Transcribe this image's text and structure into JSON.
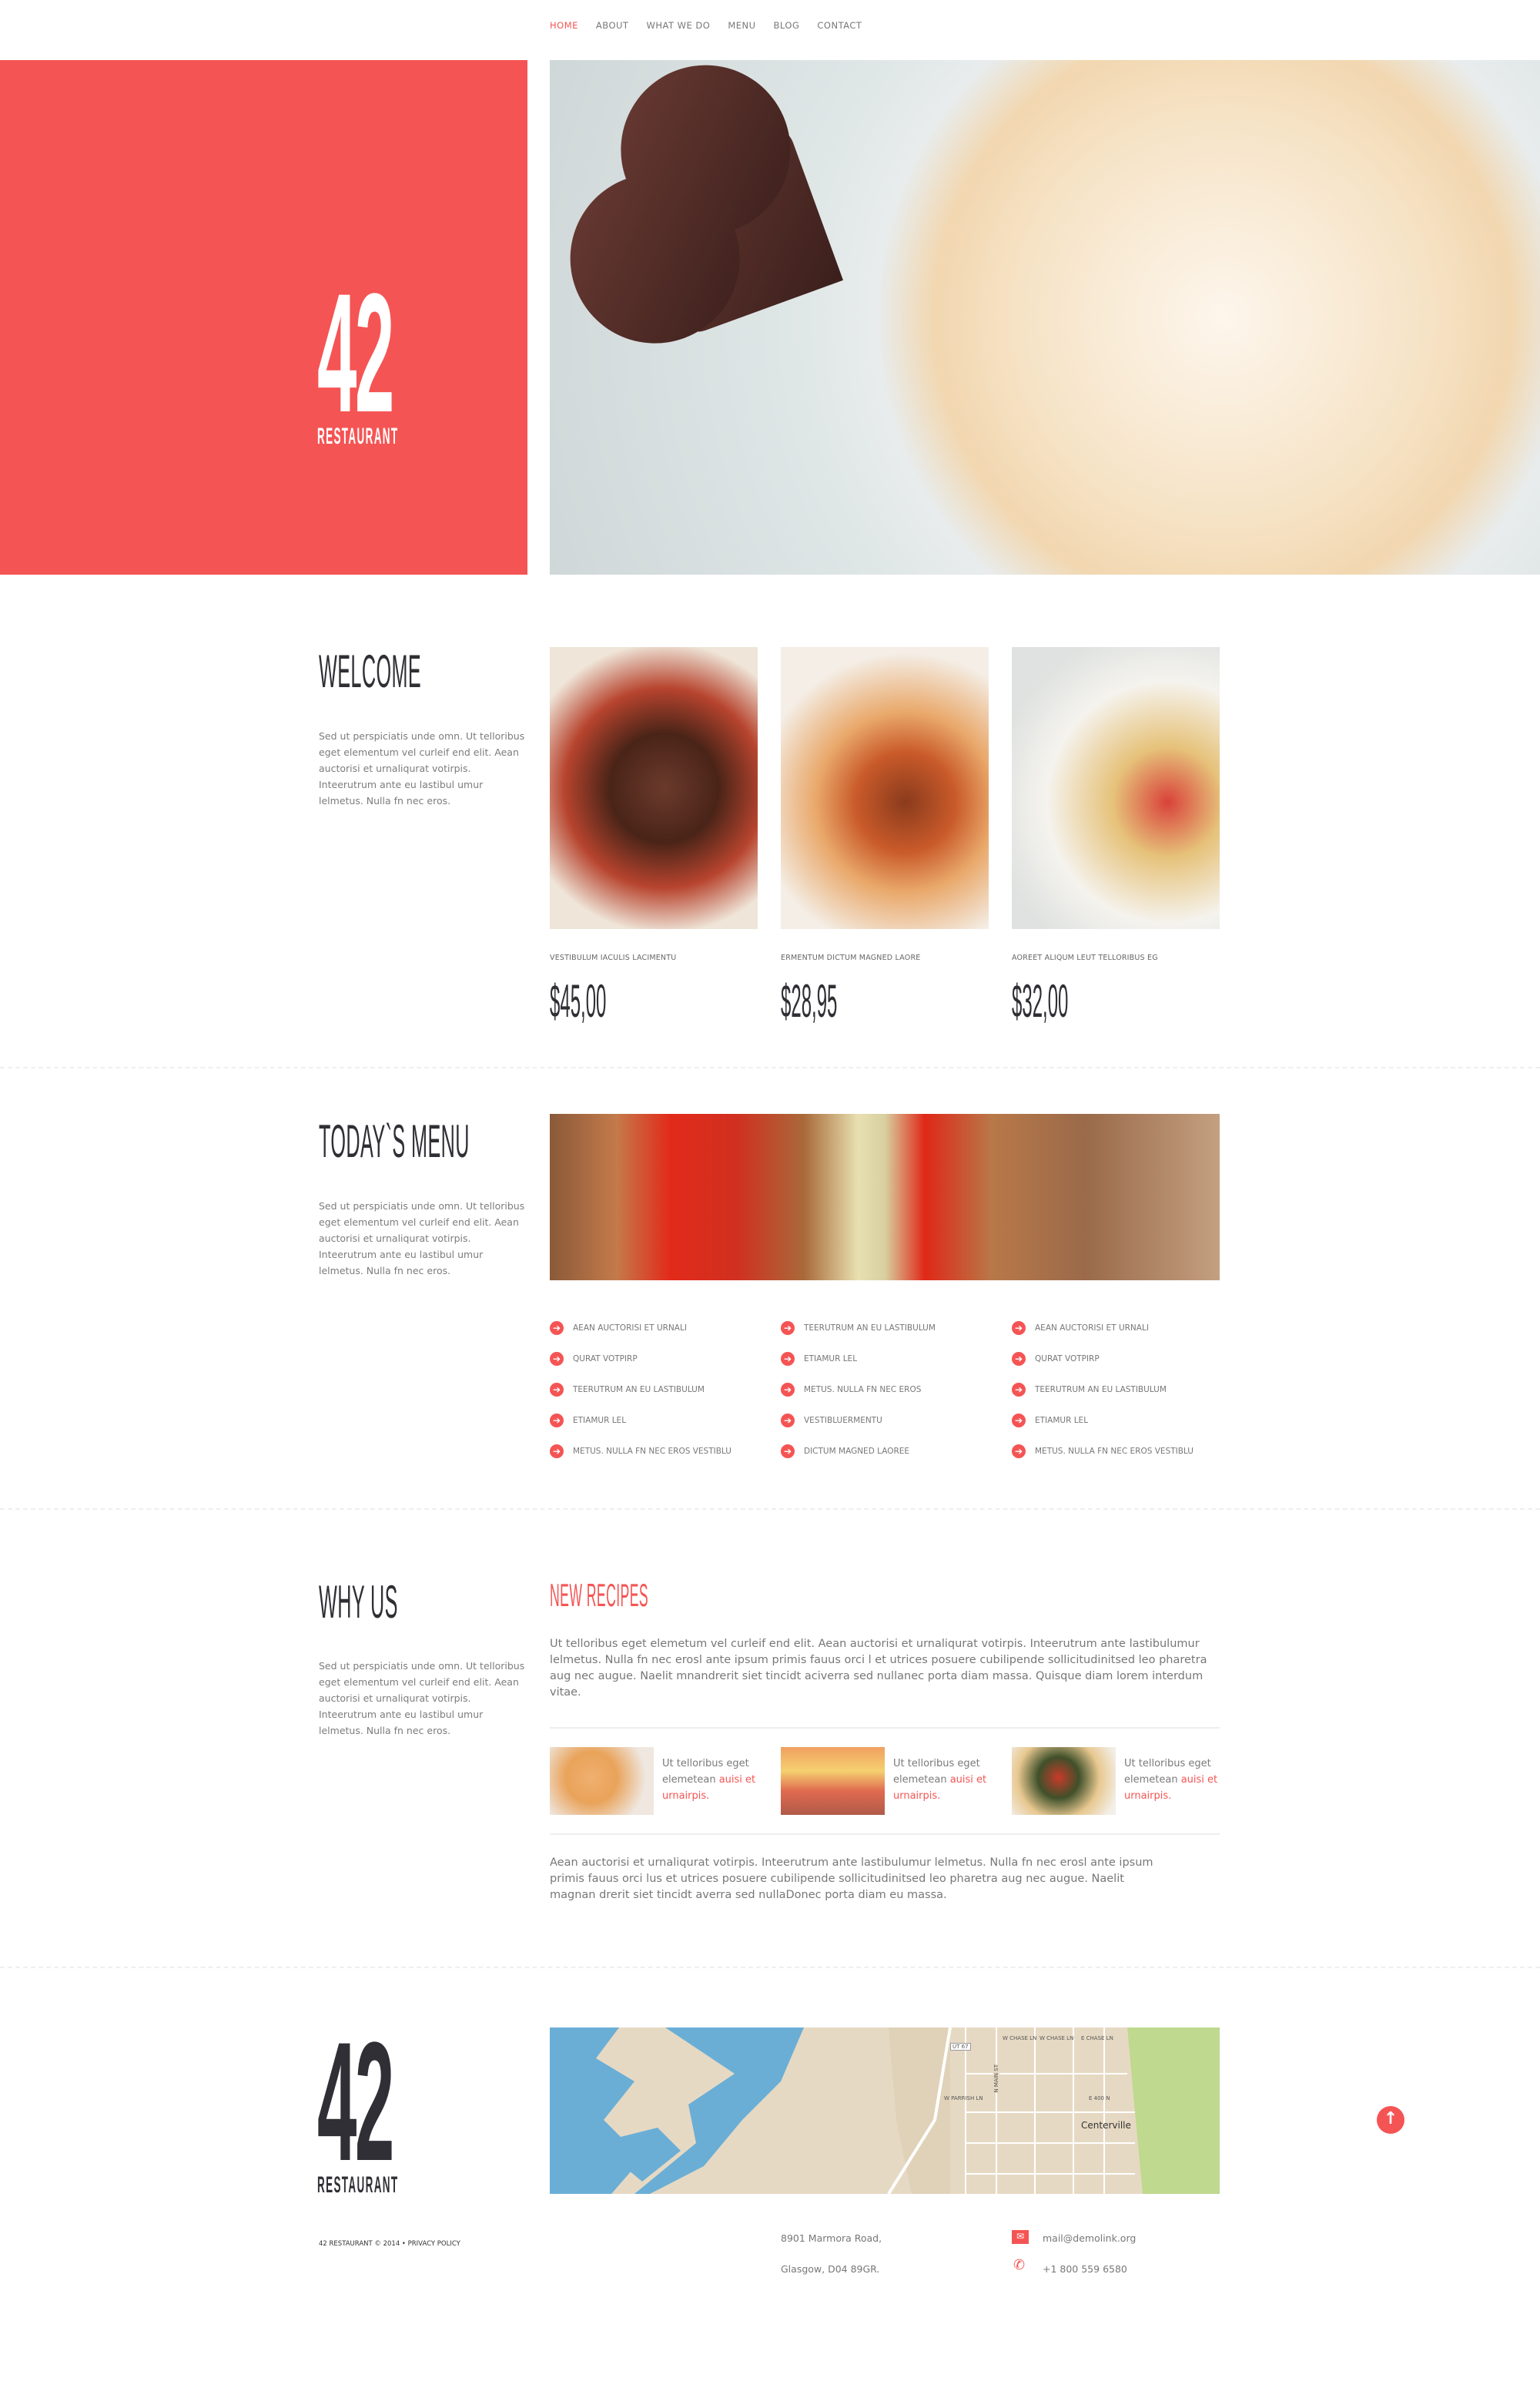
{
  "nav": {
    "items": [
      {
        "label": "HOME",
        "active": true
      },
      {
        "label": "ABOUT"
      },
      {
        "label": "WHAT WE DO"
      },
      {
        "label": "MENU"
      },
      {
        "label": "BLOG"
      },
      {
        "label": "CONTACT"
      }
    ]
  },
  "brand": {
    "number": "42",
    "word": "RESTAURANT",
    "accent": "#f55454",
    "dark": "#2f2f35"
  },
  "welcome": {
    "title": "WELCOME",
    "text": "Sed ut perspiciatis unde omn. Ut telloribus eget elementum vel curleif end elit. Aean auctorisi et urnaliqurat votirpis. Inteerutrum ante eu lastibul umur lelmetus. Nulla fn nec eros.",
    "dishes": [
      {
        "caption": "VESTIBULUM IACULIS LACIMENTU",
        "price": "$45,00"
      },
      {
        "caption": "ERMENTUM DICTUM MAGNED LAORE",
        "price": "$28,95"
      },
      {
        "caption": "AOREET ALIQUM LEUT TELLORIBUS EG",
        "price": "$32,00"
      }
    ]
  },
  "menu": {
    "title": "TODAY`S MENU",
    "text": "Sed ut perspiciatis unde omn. Ut telloribus eget elementum vel curleif end elit. Aean auctorisi et urnaliqurat votirpis. Inteerutrum ante eu lastibul umur lelmetus. Nulla fn nec eros.",
    "columns": [
      [
        "AEAN AUCTORISI ET URNALI",
        "QURAT VOTPIRP",
        "TEERUTRUM AN EU LASTIBULUM",
        "ETIAMUR LEL",
        "METUS. NULLA FN NEC EROS VESTIBLU"
      ],
      [
        "TEERUTRUM AN EU LASTIBULUM",
        "ETIAMUR LEL",
        "METUS. NULLA FN NEC EROS",
        "VESTIBLUERMENTU",
        "DICTUM MAGNED LAOREE"
      ],
      [
        "AEAN AUCTORISI ET URNALI",
        "QURAT VOTPIRP",
        "TEERUTRUM AN EU LASTIBULUM",
        "ETIAMUR LEL",
        "METUS. NULLA FN NEC EROS VESTIBLU"
      ]
    ]
  },
  "why": {
    "title": "WHY US",
    "text": "Sed ut perspiciatis unde omn. Ut telloribus eget elementum vel curleif end elit. Aean auctorisi et urnaliqurat votirpis. Inteerutrum ante eu lastibul umur lelmetus. Nulla fn nec eros.",
    "recipes_title": "NEW RECIPES",
    "intro": "Ut telloribus eget elemetum vel curleif end elit. Aean auctorisi et urnaliqurat votirpis. Inteerutrum ante lastibulumur lelmetus. Nulla fn nec erosl ante ipsum primis fauus orci l et utrices posuere cubilipende sollicitudinitsed leo pharetra aug nec augue. Naelit mnandrerit siet tincidt aciverra sed nullanec porta diam massa. Quisque diam lorem interdum vitae.",
    "recipes": [
      {
        "text": "Ut telloribus eget elemetean ",
        "link": "auisi et urnairpis."
      },
      {
        "text": "Ut telloribus eget elemetean ",
        "link": "auisi et urnairpis."
      },
      {
        "text": "Ut telloribus eget elemetean ",
        "link": "auisi et urnairpis."
      }
    ],
    "outro": "Aean auctorisi et urnaliqurat votirpis. Inteerutrum ante lastibulumur lelmetus. Nulla fn nec erosl ante ipsum primis fauus orci lus et utrices posuere cubilipende sollicitudinitsed leo pharetra aug nec augue. Naelit magnan drerit siet tincidt averra sed nullaDonec porta diam eu massa."
  },
  "map": {
    "labels": [
      "W CHASE LN",
      "W CHASE LN",
      "E CHASE LN",
      "W PARRISH LN",
      "E 400 N",
      "Centerville",
      "N MAIN ST",
      "UT 67"
    ]
  },
  "footer": {
    "copyright": "42 RESTAURANT © 2014 • ",
    "privacy": "PRIVACY POLICY",
    "address1": "8901 Marmora Road,",
    "address2": "Glasgow, D04 89GR.",
    "email": "mail@demolink.org",
    "phone": "+1 800 559 6580"
  },
  "icons": {
    "list": "arrow-circle-right",
    "email": "envelope",
    "phone": "phone",
    "top": "arrow-circle-up"
  }
}
